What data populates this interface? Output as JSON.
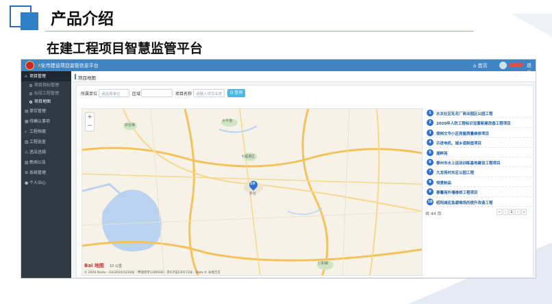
{
  "slide": {
    "title": "产品介绍",
    "subtitle": "在建工程项目智慧监管平台"
  },
  "app": {
    "title_accent": "X",
    "title": "化市建设项目监管信息平台",
    "home_label": "首页",
    "logout_label": "退出",
    "brand_red": "#c8262b",
    "primary_blue": "#3f85c6"
  },
  "sidebar": {
    "items": [
      {
        "icon": "building-icon",
        "glyph": "⌂",
        "label": "项目管理"
      },
      {
        "icon": "unit-icon",
        "glyph": "▤",
        "label": "单位管理"
      },
      {
        "icon": "calendar-icon",
        "glyph": "▦",
        "label": "待确认事项"
      },
      {
        "icon": "search-icon",
        "glyph": "⌕",
        "label": "工程档案"
      },
      {
        "icon": "file-icon",
        "glyph": "▧",
        "label": "工程巡查"
      },
      {
        "icon": "alert-icon",
        "glyph": "⚠",
        "label": "违法违规"
      },
      {
        "icon": "news-icon",
        "glyph": "▨",
        "label": "新闻公告"
      },
      {
        "icon": "gear-icon",
        "glyph": "⚙",
        "label": "系统管理"
      },
      {
        "icon": "user-icon",
        "glyph": "●",
        "label": "个人中心"
      }
    ],
    "subitems": [
      "项目指标管理",
      "标段工程管理",
      "项目地图"
    ]
  },
  "page": {
    "heading": "项目地图"
  },
  "filters": {
    "org_label": "所属单位",
    "org_placeholder": "请选择单位",
    "area_label": "区域",
    "area_placeholder": "",
    "name_label": "项目名称",
    "name_placeholder": "请输入项目名称",
    "search_label": "Q 查询"
  },
  "map": {
    "marker_label": "10",
    "zoom_in": "+",
    "zoom_out": "−",
    "logo": "Bai 地图",
    "scale": "10 公里",
    "copyright": "© 2020 Baidu - GS(2019)5218号 - 甲测资字1100930 - 京ICP证030173号 - Data © 长地万方",
    "places": [
      "大丰港",
      "十福港区",
      "双合镇",
      "东台",
      "仁和镇"
    ]
  },
  "projects": [
    {
      "num": "1",
      "name": "水关社区轧花厂商业园区公园工程"
    },
    {
      "num": "2",
      "name": "2020年人防工程标识设置新建改造工程项目"
    },
    {
      "num": "3",
      "name": "提档文华小区房屋质量维修项目"
    },
    {
      "num": "4",
      "name": "示进电机、城乡道制造项目"
    },
    {
      "num": "5",
      "name": "湖畔苑"
    },
    {
      "num": "6",
      "name": "泰州市水上运动训练基地建设工程项目"
    },
    {
      "num": "7",
      "name": "九龙苑村东区公园工程"
    },
    {
      "num": "8",
      "name": "恒景制品"
    },
    {
      "num": "9",
      "name": "泰馨苑外墙维修工程项目"
    },
    {
      "num": "10",
      "name": "昭阳城应急避难场所提升改造工程"
    }
  ],
  "pagination": {
    "total": "共 44 页",
    "first": "«",
    "prev": "‹",
    "current": "1",
    "next": "›",
    "last": "»"
  }
}
